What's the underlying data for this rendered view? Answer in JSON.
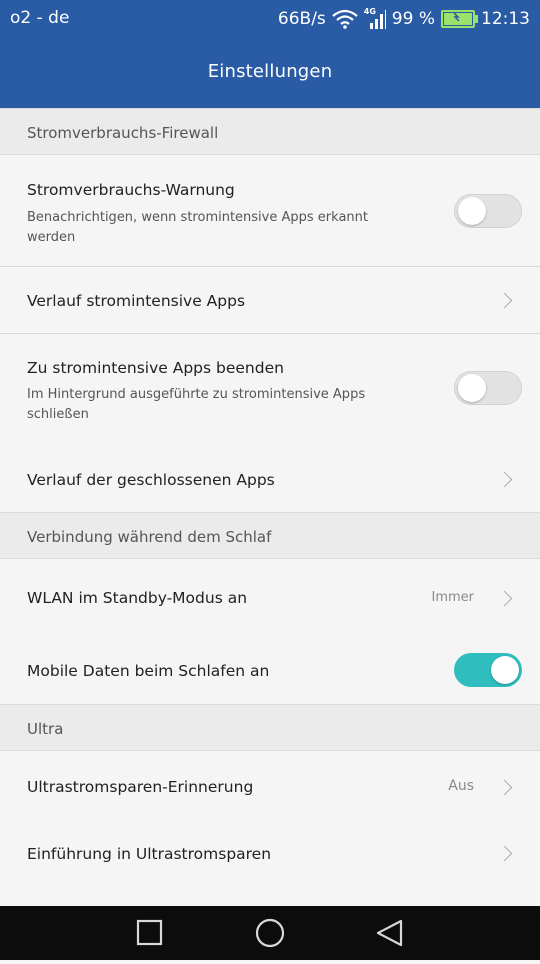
{
  "status_bar": {
    "carrier": "o2 - de",
    "net_speed": "66B/s",
    "network_type": "4G",
    "battery_percent": "99 %",
    "time": "12:13"
  },
  "header": {
    "title": "Einstellungen"
  },
  "sections": [
    {
      "title": "Stromverbrauchs-Firewall",
      "rows": [
        {
          "title": "Stromverbrauchs-Warnung",
          "subtitle": "Benachrichtigen, wenn stromintensive Apps erkannt werden",
          "control": "toggle",
          "on": false
        },
        {
          "title": "Verlauf stromintensive Apps",
          "control": "chevron"
        },
        {
          "title": "Zu stromintensive Apps beenden",
          "subtitle": "Im Hintergrund ausgeführte zu stromintensive Apps schließen",
          "control": "toggle",
          "on": false
        },
        {
          "title": "Verlauf der geschlossenen Apps",
          "control": "chevron"
        }
      ]
    },
    {
      "title": "Verbindung während dem Schlaf",
      "rows": [
        {
          "title": "WLAN im Standby-Modus an",
          "value": "Immer",
          "control": "chevron"
        },
        {
          "title": "Mobile Daten beim Schlafen an",
          "control": "toggle",
          "on": true
        }
      ]
    },
    {
      "title": "Ultra",
      "rows": [
        {
          "title": "Ultrastromsparen-Erinnerung",
          "value": "Aus",
          "control": "chevron"
        },
        {
          "title": "Einführung in Ultrastromsparen",
          "control": "chevron"
        }
      ]
    }
  ],
  "colors": {
    "accent": "#2a5ba5",
    "toggle_on": "#2fbdbd",
    "battery": "#9be26b"
  },
  "nav_bar": {
    "icons": [
      "recent-apps-icon",
      "home-icon",
      "back-icon"
    ]
  }
}
